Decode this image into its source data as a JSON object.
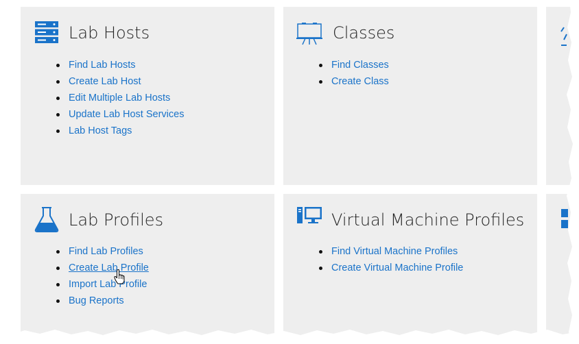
{
  "panels": {
    "lab_hosts": {
      "title": "Lab Hosts",
      "icon": "server-rack-icon",
      "links": [
        "Find Lab Hosts",
        "Create Lab Host",
        "Edit Multiple Lab Hosts",
        "Update Lab Host Services",
        "Lab Host Tags"
      ]
    },
    "classes": {
      "title": "Classes",
      "icon": "presentation-board-icon",
      "links": [
        "Find Classes",
        "Create Class"
      ]
    },
    "lab_profiles": {
      "title": "Lab Profiles",
      "icon": "flask-icon",
      "links": [
        "Find Lab Profiles",
        "Create Lab Profile",
        "Import Lab Profile",
        "Bug Reports"
      ],
      "hovered_link": "Create Lab Profile"
    },
    "virtual_machine_profiles": {
      "title": "Virtual Machine Profiles",
      "icon": "desktop-computer-icon",
      "links": [
        "Find Virtual Machine Profiles",
        "Create Virtual Machine Profile"
      ]
    }
  },
  "colors": {
    "link": "#1a73c9",
    "icon": "#1a73c9",
    "panel_bg": "#eeeeee",
    "title": "#222222"
  },
  "cursor": "hand-pointer-icon"
}
